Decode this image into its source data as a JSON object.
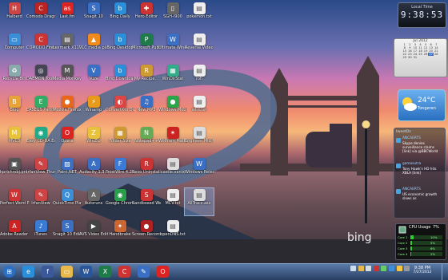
{
  "icons": [
    {
      "label": "Halberd",
      "glyph": "H",
      "color": "#c44"
    },
    {
      "label": "Computer",
      "glyph": "▭",
      "color": "#3a8fd8"
    },
    {
      "label": "Recycle Bin",
      "glyph": "♻",
      "color": "#8aa"
    },
    {
      "label": "Blog",
      "glyph": "B",
      "color": "#e8a23a"
    },
    {
      "label": "MVC3",
      "glyph": "M",
      "color": "#e8c23a"
    },
    {
      "label": "hprichrsbj.png",
      "glyph": "▣",
      "color": "#555"
    },
    {
      "label": "Perfect Word PRI...",
      "glyph": "W",
      "color": "#c33"
    },
    {
      "label": "Adobe Reader X",
      "glyph": "A",
      "color": "#c22"
    },
    {
      "label": "Comodo Dragon",
      "glyph": "C",
      "color": "#b22"
    },
    {
      "label": "COMODO Firewall",
      "glyph": "C",
      "color": "#c33"
    },
    {
      "label": "DAEMON Tools Lite",
      "glyph": "◎",
      "color": "#445"
    },
    {
      "label": "EASEUS Partition ...",
      "glyph": "E",
      "color": "#3a6"
    },
    {
      "label": "Easy CD-DA Extractor",
      "glyph": "◉",
      "color": "#2a8"
    },
    {
      "label": "IrfanView Thumbnails",
      "glyph": "✎",
      "color": "#c44"
    },
    {
      "label": "IrfanView",
      "glyph": "✎",
      "color": "#c44"
    },
    {
      "label": "iTunes",
      "glyph": "♪",
      "color": "#3a7bd5"
    },
    {
      "label": "Last.fm",
      "glyph": "as",
      "color": "#d22"
    },
    {
      "label": "Lexmark X1100 Seri...",
      "glyph": "▤",
      "color": "#666"
    },
    {
      "label": "Media Monkey",
      "glyph": "M",
      "color": "#555"
    },
    {
      "label": "Mozilla Firefox",
      "glyph": "●",
      "color": "#e8671a"
    },
    {
      "label": "Opera",
      "glyph": "O",
      "color": "#d22"
    },
    {
      "label": "Paint.NET",
      "glyph": "▨",
      "color": "#3a6fc4"
    },
    {
      "label": "QuickTime Player",
      "glyph": "Q",
      "color": "#3a8fd8"
    },
    {
      "label": "Snagit 10 Editor",
      "glyph": "S",
      "color": "#3a6fc4"
    },
    {
      "label": "Snagit 10",
      "glyph": "S",
      "color": "#3a6fc4"
    },
    {
      "label": "VLC media player",
      "glyph": "▲",
      "color": "#f08a1a"
    },
    {
      "label": "Vuze",
      "glyph": "V",
      "color": "#3a6fc4"
    },
    {
      "label": "Winamp",
      "glyph": "⚡",
      "color": "#e89a1a"
    },
    {
      "label": "WinZip",
      "glyph": "Z",
      "color": "#e8c23a"
    },
    {
      "label": "Audacity 1.3 Beta (Unic...",
      "glyph": "A",
      "color": "#3a6fc4"
    },
    {
      "label": "Autoruns",
      "glyph": "A",
      "color": "#666"
    },
    {
      "label": "AVS Video Editor",
      "glyph": "▶",
      "color": "#444"
    },
    {
      "label": "Bing Daily",
      "glyph": "b",
      "color": "#2a8fd8"
    },
    {
      "label": "Bing Desktop",
      "glyph": "b",
      "color": "#2a8fd8"
    },
    {
      "label": "Bing Download...",
      "glyph": "b",
      "color": "#2a8fd8"
    },
    {
      "label": "ConvertXto DVD 4",
      "glyph": "◐",
      "color": "#d44"
    },
    {
      "label": "Folder Size",
      "glyph": "▦",
      "color": "#c93"
    },
    {
      "label": "FrostWire 4.21.8",
      "glyph": "F",
      "color": "#3a7bd5"
    },
    {
      "label": "Google Chrome",
      "glyph": "◉",
      "color": "#2a9d4a"
    },
    {
      "label": "Handbrake",
      "glyph": "✦",
      "color": "#c63"
    },
    {
      "label": "Hero Editor",
      "glyph": "✚",
      "color": "#c33"
    },
    {
      "label": "Microsoft Publish...",
      "glyph": "P",
      "color": "#1f7a4a"
    },
    {
      "label": "My Recipe...",
      "glyph": "R",
      "color": "#c93"
    },
    {
      "label": "New MP3",
      "glyph": "♫",
      "color": "#3a6fc4"
    },
    {
      "label": "Notepad++",
      "glyph": "N",
      "color": "#6a5"
    },
    {
      "label": "Revo Uninstaller",
      "glyph": "R",
      "color": "#c33"
    },
    {
      "label": "Sandboxed Web Browser",
      "glyph": "S",
      "color": "#c33"
    },
    {
      "label": "Screen Recorder",
      "glyph": "●",
      "color": "#a22"
    },
    {
      "label": "SGH-I900",
      "glyph": "▯",
      "color": "#666"
    },
    {
      "label": "Ultimate Windows...",
      "glyph": "W",
      "color": "#3a6fc4"
    },
    {
      "label": "WinDirStat",
      "glyph": "▦",
      "color": "#3a8"
    },
    {
      "label": "Windows Mobile...",
      "glyph": "●",
      "color": "#2aa54a"
    },
    {
      "label": "Wolfram Mathemat...",
      "glyph": "✶",
      "color": "#c22"
    },
    {
      "label": "castle.vanix",
      "glyph": "▤",
      "color": "#ddd"
    },
    {
      "label": "MCV.txt",
      "glyph": "▤",
      "color": "#eee"
    },
    {
      "label": "openDNS.txt",
      "glyph": "▤",
      "color": "#eee"
    },
    {
      "label": "pokemon.txt",
      "glyph": "▤",
      "color": "#eee"
    },
    {
      "label": "Reverse Videos...",
      "glyph": "▤",
      "color": "#eee"
    },
    {
      "label": "roh",
      "glyph": "▤",
      "color": "#eee"
    },
    {
      "label": "wlid.txt",
      "glyph": "▤",
      "color": "#eee"
    },
    {
      "label": "Engineer Mid fix.bat",
      "glyph": "▤",
      "color": "#ddd"
    },
    {
      "label": "Windows ReleasePre...",
      "glyph": "W",
      "color": "#3a6fc4"
    },
    {
      "label": "AllTracz.asx",
      "glyph": "▤",
      "color": "#ddd"
    }
  ],
  "clock_gadget": {
    "title": "Local Time",
    "time": "9:38:53"
  },
  "calendar_gadget": {
    "month": "Jul 2012",
    "weeks": [
      [
        "1",
        "2",
        "3",
        "4",
        "5",
        "6",
        "7"
      ],
      [
        "8",
        "9",
        "10",
        "11",
        "12",
        "13",
        "14"
      ],
      [
        "15",
        "16",
        "17",
        "18",
        "19",
        "20",
        "21"
      ],
      [
        "22",
        "23",
        "24",
        "25",
        "26",
        "27",
        "28"
      ],
      [
        "29",
        "30",
        "31",
        "",
        "",
        "",
        ""
      ]
    ]
  },
  "weather_gadget": {
    "temp": "24°C",
    "city": "Tongeren"
  },
  "news_gadget": {
    "source": "tweetDz",
    "items": [
      {
        "name": "ANCAERTS",
        "text": "Skype denies surveillance claims [link] via @BBCWorld"
      },
      {
        "name": "gamasutra",
        "text": "Tony Hawk's HD hits XBLA [link]"
      },
      {
        "name": "ANCAERTS",
        "text": "US economic growth slows as"
      }
    ]
  },
  "cpu_gadget": {
    "title": "CPU Usage",
    "percent": "7%",
    "cores": [
      {
        "label": "Core 1",
        "percent": "10%",
        "value": 0.1
      },
      {
        "label": "Core 2",
        "percent": "5%",
        "value": 0.05
      },
      {
        "label": "Core 3",
        "percent": "6%",
        "value": 0.06
      },
      {
        "label": "Core 4",
        "percent": "2%",
        "value": 0.02
      }
    ]
  },
  "wallpaper": {
    "watermark": "bing"
  },
  "taskbar": {
    "apps": [
      {
        "name": "start-button",
        "glyph": "⊞",
        "color": "#2a6fc4"
      },
      {
        "name": "internet-explorer",
        "glyph": "e",
        "color": "#2a8fd8"
      },
      {
        "name": "facebook",
        "glyph": "f",
        "color": "#3b5998"
      },
      {
        "name": "folder",
        "glyph": "▭",
        "color": "#e8b84a"
      },
      {
        "name": "word",
        "glyph": "W",
        "color": "#2a5699"
      },
      {
        "name": "excel",
        "glyph": "X",
        "color": "#1f7a4a"
      },
      {
        "name": "comodo-dragon",
        "glyph": "C",
        "color": "#c33"
      },
      {
        "name": "paint",
        "glyph": "✎",
        "color": "#3a6fc4"
      },
      {
        "name": "opera",
        "glyph": "O",
        "color": "#d22"
      }
    ],
    "time": "9:38 PM",
    "date": "7/27/2012"
  }
}
